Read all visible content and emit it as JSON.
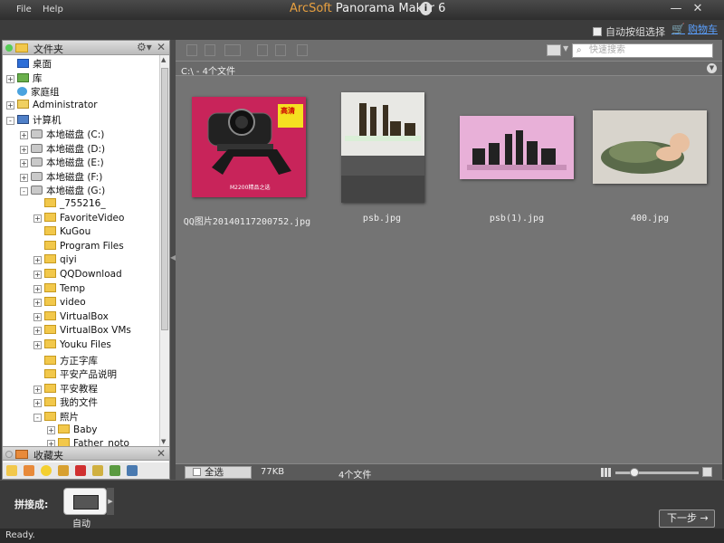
{
  "menu": {
    "file": "File",
    "help": "Help"
  },
  "app": {
    "brand": "ArcSoft",
    "title": "Panorama Maker 6"
  },
  "window": {
    "minimize": "—",
    "close": "✕"
  },
  "top": {
    "auto_group_label": "自动按组选择",
    "cart_label": "购物车"
  },
  "folders_panel": {
    "title": "文件夹"
  },
  "tree": [
    {
      "label": "桌面",
      "icon": "desktop-icon",
      "indent": 0,
      "expander": "none"
    },
    {
      "label": "库",
      "icon": "library-icon",
      "indent": 0,
      "expander": "+"
    },
    {
      "label": "家庭组",
      "icon": "homegroup-icon",
      "indent": 0,
      "expander": "none"
    },
    {
      "label": "Administrator",
      "icon": "user-folder-icon",
      "indent": 0,
      "expander": "+"
    },
    {
      "label": "计算机",
      "icon": "computer-icon",
      "indent": 0,
      "expander": "-"
    },
    {
      "label": "本地磁盘 (C:)",
      "icon": "drive-icon",
      "indent": 1,
      "expander": "+"
    },
    {
      "label": "本地磁盘 (D:)",
      "icon": "drive-icon",
      "indent": 1,
      "expander": "+"
    },
    {
      "label": "本地磁盘 (E:)",
      "icon": "drive-icon",
      "indent": 1,
      "expander": "+"
    },
    {
      "label": "本地磁盘 (F:)",
      "icon": "drive-icon",
      "indent": 1,
      "expander": "+"
    },
    {
      "label": "本地磁盘 (G:)",
      "icon": "drive-icon",
      "indent": 1,
      "expander": "-"
    },
    {
      "label": "_755216_",
      "icon": "folder-icon",
      "indent": 2,
      "expander": "none"
    },
    {
      "label": "FavoriteVideo",
      "icon": "folder-icon",
      "indent": 2,
      "expander": "+"
    },
    {
      "label": "KuGou",
      "icon": "folder-icon",
      "indent": 2,
      "expander": "none"
    },
    {
      "label": "Program Files",
      "icon": "folder-icon",
      "indent": 2,
      "expander": "none"
    },
    {
      "label": "qiyi",
      "icon": "folder-icon",
      "indent": 2,
      "expander": "+"
    },
    {
      "label": "QQDownload",
      "icon": "folder-icon",
      "indent": 2,
      "expander": "+"
    },
    {
      "label": "Temp",
      "icon": "folder-icon",
      "indent": 2,
      "expander": "+"
    },
    {
      "label": "video",
      "icon": "folder-icon",
      "indent": 2,
      "expander": "+"
    },
    {
      "label": "VirtualBox",
      "icon": "folder-icon",
      "indent": 2,
      "expander": "+"
    },
    {
      "label": "VirtualBox VMs",
      "icon": "folder-icon",
      "indent": 2,
      "expander": "+"
    },
    {
      "label": "Youku Files",
      "icon": "folder-icon",
      "indent": 2,
      "expander": "+"
    },
    {
      "label": "方正字库",
      "icon": "folder-icon",
      "indent": 2,
      "expander": "none"
    },
    {
      "label": "平安产品说明",
      "icon": "folder-icon",
      "indent": 2,
      "expander": "none"
    },
    {
      "label": "平安教程",
      "icon": "folder-icon",
      "indent": 2,
      "expander": "+"
    },
    {
      "label": "我的文件",
      "icon": "folder-icon",
      "indent": 2,
      "expander": "+"
    },
    {
      "label": "照片",
      "icon": "folder-icon",
      "indent": 2,
      "expander": "-"
    },
    {
      "label": "Baby",
      "icon": "folder-icon",
      "indent": 3,
      "expander": "+"
    },
    {
      "label": "Father_noto",
      "icon": "folder-icon",
      "indent": 3,
      "expander": "+"
    }
  ],
  "favorites_panel": {
    "title": "收藏夹"
  },
  "search": {
    "placeholder": "快速搜索"
  },
  "path": {
    "text": "C:\\ - 4个文件"
  },
  "files": [
    {
      "name": "QQ图片20140117200752.jpg"
    },
    {
      "name": "psb.jpg"
    },
    {
      "name": "psb(1).jpg"
    },
    {
      "name": "400.jpg"
    }
  ],
  "photo_text": {
    "webcam_banner": "高清",
    "webcam_caption": "M2200精品之选"
  },
  "status": {
    "select_all": "全选",
    "size": "77KB",
    "count": "4个文件"
  },
  "bottom": {
    "stitch_label": "拼接成:",
    "auto_label": "自动",
    "next_label": "下一步 →"
  },
  "footer": {
    "status": "Ready."
  },
  "colors": {
    "accent_brand": "#e8a040",
    "link": "#5aa0ff",
    "folder": "#f2c84b"
  }
}
